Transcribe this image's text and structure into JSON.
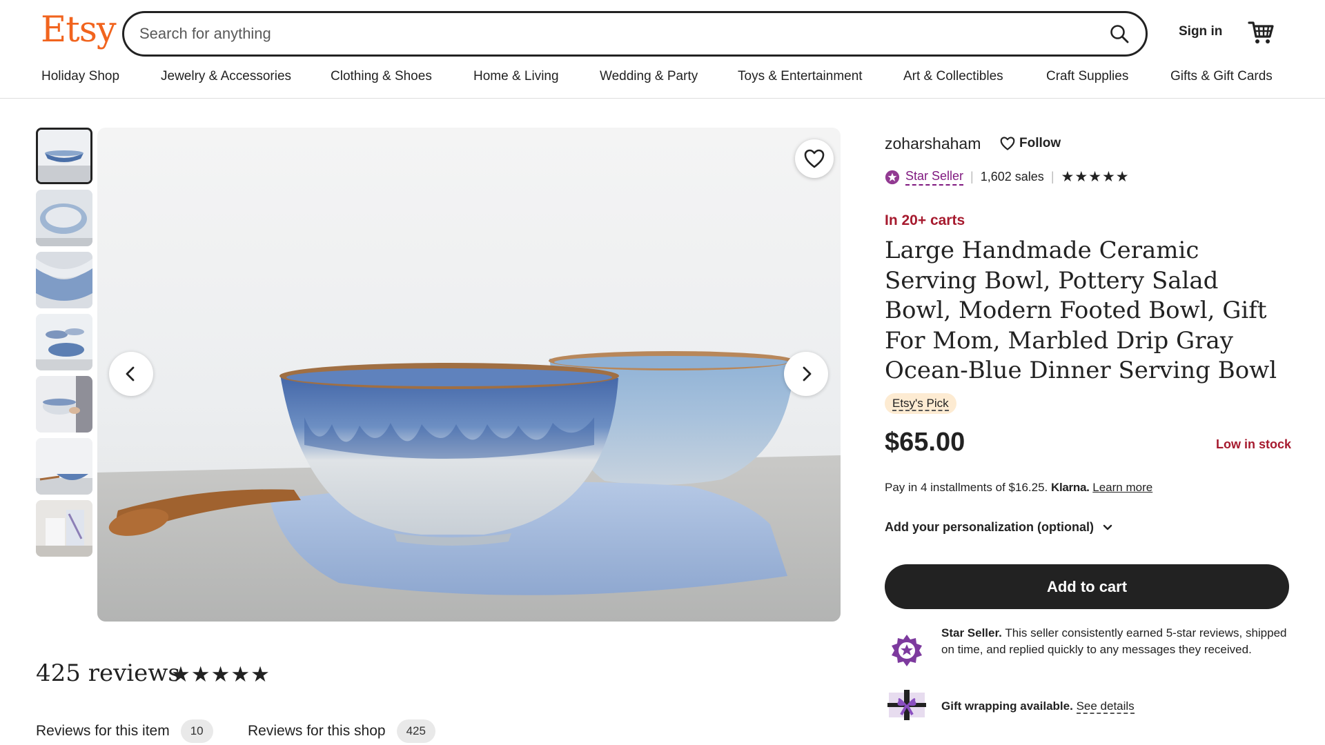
{
  "header": {
    "logo": "Etsy",
    "search_placeholder": "Search for anything",
    "sign_in": "Sign in",
    "categories": [
      "Holiday Shop",
      "Jewelry & Accessories",
      "Clothing & Shoes",
      "Home & Living",
      "Wedding & Party",
      "Toys & Entertainment",
      "Art & Collectibles",
      "Craft Supplies",
      "Gifts & Gift Cards"
    ]
  },
  "seller": {
    "shop_name": "zoharshaham",
    "follow": "Follow",
    "star_seller": "Star Seller",
    "sales": "1,602 sales",
    "rating": "★★★★★"
  },
  "listing": {
    "in_carts": "In 20+ carts",
    "title": "Large Handmade Ceramic Serving Bowl, Pottery Salad Bowl, Modern Footed Bowl, Gift For Mom, Marbled Drip Gray Ocean-Blue Dinner Serving Bowl",
    "badge": "Etsy's Pick",
    "price": "$65.00",
    "stock": "Low in stock",
    "installments_text": "Pay in 4 installments of $16.25.",
    "klarna": "Klarna.",
    "learn_more": "Learn more",
    "personalization": "Add your personalization (optional)",
    "add_to_cart": "Add to cart"
  },
  "perks": {
    "star_seller_title": "Star Seller.",
    "star_seller_desc": "This seller consistently earned 5-star reviews, shipped on time, and replied quickly to any messages they received.",
    "gift_title": "Gift wrapping available.",
    "gift_link": "See details"
  },
  "reviews": {
    "title": "425 reviews",
    "stars": "★★★★★",
    "tab_item": "Reviews for this item",
    "tab_item_count": "10",
    "tab_shop": "Reviews for this shop",
    "tab_shop_count": "425"
  },
  "colors": {
    "brand": "#f1641e",
    "star_seller": "#7f187f",
    "alert": "#a61a2e"
  }
}
